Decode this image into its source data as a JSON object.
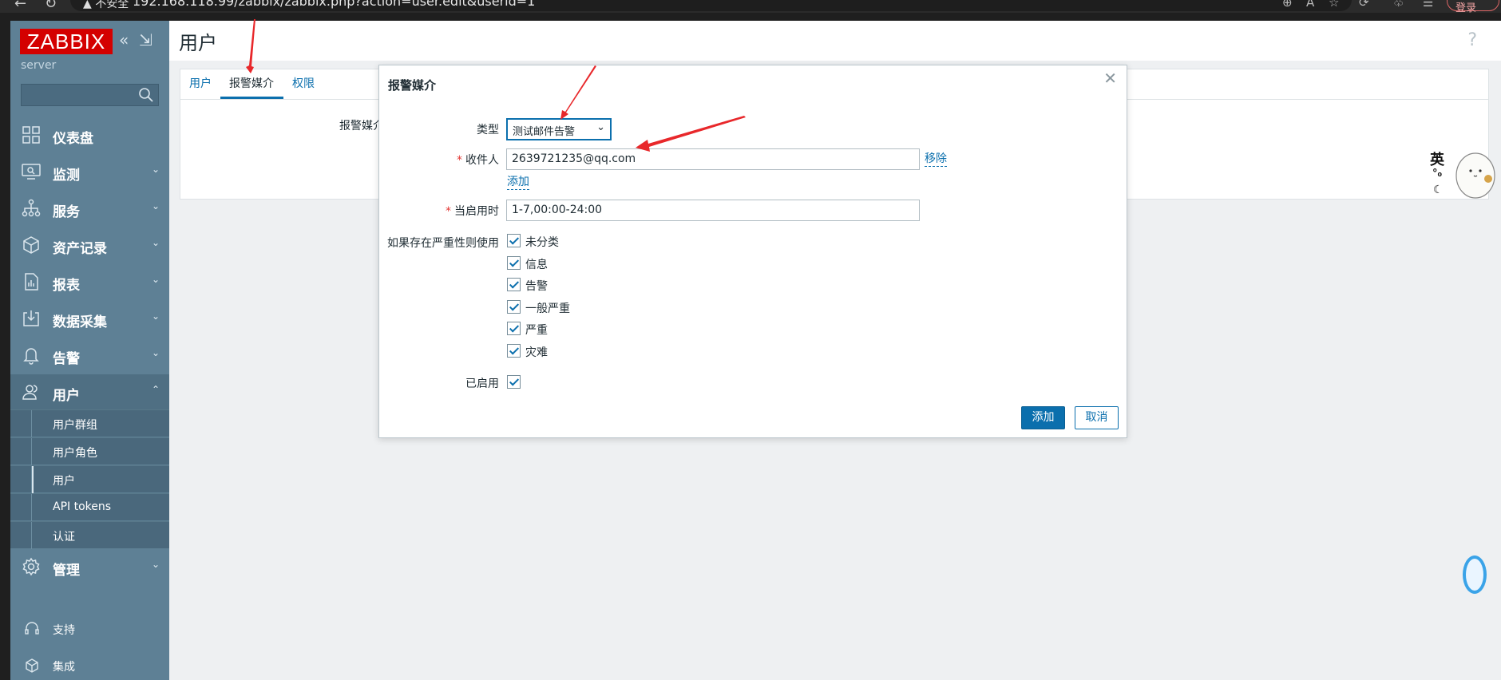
{
  "browser": {
    "security_label": "不安全",
    "url": "192.168.118.99/zabbix/zabbix.php?action=user.edit&userid=1",
    "login_label": "登录"
  },
  "sidebar": {
    "logo": "ZABBIX",
    "server": "server",
    "menu": [
      {
        "label": "仪表盘",
        "icon": "dashboard-icon"
      },
      {
        "label": "监测",
        "icon": "monitoring-icon"
      },
      {
        "label": "服务",
        "icon": "services-icon"
      },
      {
        "label": "资产记录",
        "icon": "inventory-icon"
      },
      {
        "label": "报表",
        "icon": "reports-icon"
      },
      {
        "label": "数据采集",
        "icon": "data-collection-icon"
      },
      {
        "label": "告警",
        "icon": "alerts-icon"
      },
      {
        "label": "用户",
        "icon": "users-icon"
      }
    ],
    "users_submenu": [
      "用户群组",
      "用户角色",
      "用户",
      "API tokens",
      "认证"
    ],
    "admin": {
      "label": "管理",
      "icon": "gear-icon"
    },
    "support": "支持",
    "integrations": "集成"
  },
  "page": {
    "title": "用户",
    "tabs": [
      "用户",
      "报警媒介",
      "权限"
    ],
    "active_tab": "报警媒介",
    "bg_field_label": "报警媒介",
    "deco_chars": [
      "英",
      "°₀",
      "☾"
    ]
  },
  "dialog": {
    "title": "报警媒介",
    "type_label": "类型",
    "type_value": "测试邮件告警",
    "recipient_label": "收件人",
    "recipient_value": "2639721235@qq.com",
    "remove_label": "移除",
    "add_link_label": "添加",
    "when_active_label": "当启用时",
    "when_active_value": "1-7,00:00-24:00",
    "severity_label": "如果存在严重性则使用",
    "severities": [
      "未分类",
      "信息",
      "告警",
      "一般严重",
      "严重",
      "灾难"
    ],
    "enabled_label": "已启用",
    "submit_label": "添加",
    "cancel_label": "取消"
  },
  "colors": {
    "sidebar_bg": "#5e8095",
    "logo_red": "#d40000",
    "accent_blue": "#0b6fad",
    "annotation_red": "#e8282b"
  }
}
